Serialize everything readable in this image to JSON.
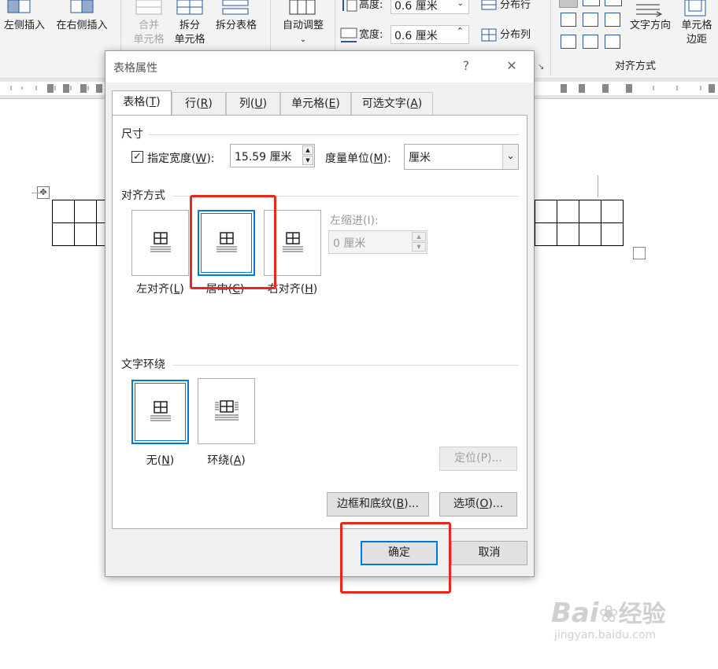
{
  "ribbon": {
    "insert_left": "左侧插入",
    "insert_right": "在右侧插入",
    "merge": "合并",
    "merge_cells": "单元格",
    "split": "拆分",
    "split_cells": "单元格",
    "split_table": "拆分表格",
    "autofit": "自动调整",
    "height_label": "高度:",
    "height_value": "0.6 厘米",
    "width_label": "宽度:",
    "width_value": "0.6 厘米",
    "distribute_rows": "分布行",
    "distribute_cols": "分布列",
    "text_direction": "文字方向",
    "cell_margins_1": "单元格",
    "cell_margins_2": "边距",
    "alignment_group": "对齐方式"
  },
  "dialog": {
    "title": "表格属性",
    "help": "?",
    "close": "✕",
    "tabs": [
      {
        "label": "表格(",
        "key": "T",
        "suffix": ")"
      },
      {
        "label": "行(",
        "key": "R",
        "suffix": ")"
      },
      {
        "label": "列(",
        "key": "U",
        "suffix": ")"
      },
      {
        "label": "单元格(",
        "key": "E",
        "suffix": ")"
      },
      {
        "label": "可选文字(",
        "key": "A",
        "suffix": ")"
      }
    ],
    "size_section": "尺寸",
    "preferred_width_checked": true,
    "preferred_width_label": "指定宽度(",
    "preferred_width_key": "W",
    "preferred_width_suffix": "):",
    "preferred_width_value": "15.59 厘米",
    "measure_in_label": "度量单位(",
    "measure_in_key": "M",
    "measure_in_suffix": "):",
    "measure_in_value": "厘米",
    "alignment_section": "对齐方式",
    "align_left": {
      "label": "左对齐(",
      "key": "L",
      "suffix": ")"
    },
    "align_center": {
      "label": "居中(",
      "key": "C",
      "suffix": ")"
    },
    "align_right": {
      "label": "右对齐(",
      "key": "H",
      "suffix": ")"
    },
    "indent_label": "左缩进(I):",
    "indent_value": "0 厘米",
    "wrap_section": "文字环绕",
    "wrap_none": {
      "label": "无(",
      "key": "N",
      "suffix": ")"
    },
    "wrap_around": {
      "label": "环绕(",
      "key": "A",
      "suffix": ")"
    },
    "positioning": "定位(P)...",
    "borders_shading": {
      "label": "边框和底纹(",
      "key": "B",
      "suffix": ")..."
    },
    "options": {
      "label": "选项(",
      "key": "O",
      "suffix": ")..."
    },
    "ok": "确定",
    "cancel": "取消"
  },
  "watermark": {
    "brand": "Bai",
    "brand_cn": "经验",
    "url": "jingyan.baidu.com"
  },
  "colors": {
    "selection_blue": "#0078d7",
    "highlight_red": "#e8271f"
  }
}
